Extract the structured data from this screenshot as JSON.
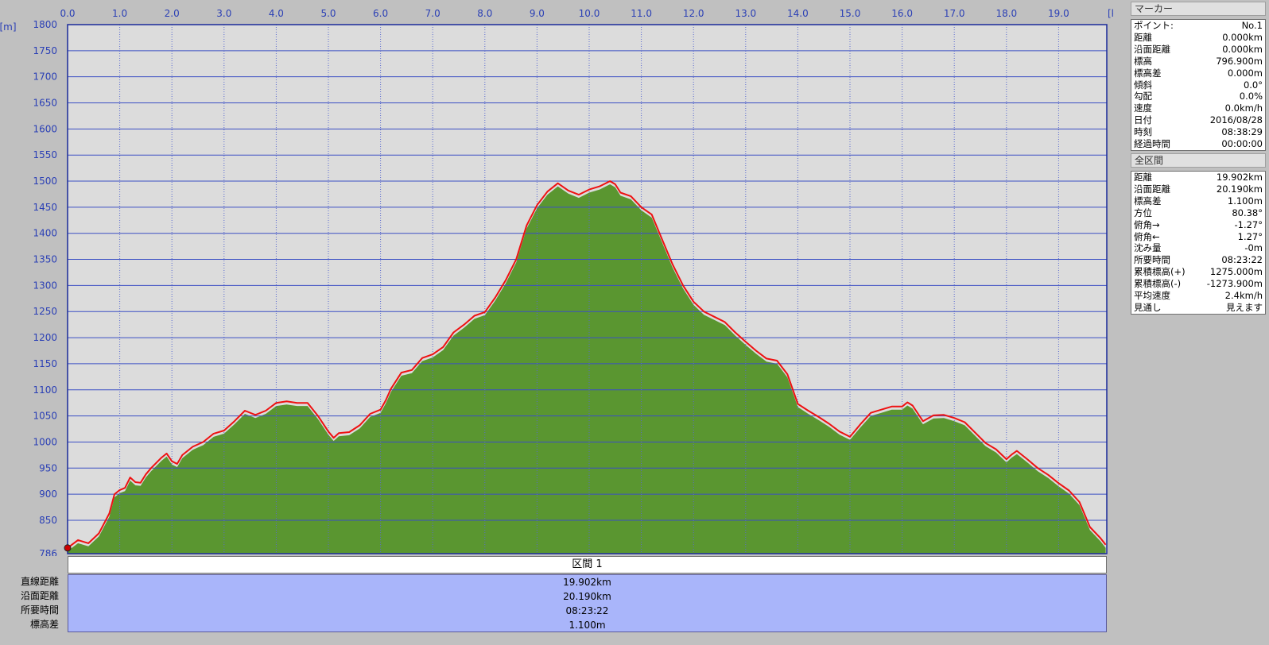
{
  "chart_data": {
    "type": "area",
    "xlabel": "[km]",
    "ylabel": "[m]",
    "xlim": [
      0,
      19.902
    ],
    "ylim": [
      786,
      1800
    ],
    "x_ticks": [
      "0.0",
      "1.0",
      "2.0",
      "3.0",
      "4.0",
      "5.0",
      "6.0",
      "7.0",
      "8.0",
      "9.0",
      "10.0",
      "11.0",
      "12.0",
      "13.0",
      "14.0",
      "15.0",
      "16.0",
      "17.0",
      "18.0",
      "19.0"
    ],
    "y_ticks": [
      "786",
      "850",
      "900",
      "950",
      "1000",
      "1050",
      "1100",
      "1150",
      "1200",
      "1250",
      "1300",
      "1350",
      "1400",
      "1450",
      "1500",
      "1550",
      "1600",
      "1650",
      "1700",
      "1750",
      "1800"
    ],
    "grid": true,
    "series": [
      {
        "x": [
          0,
          0.2,
          0.4,
          0.6,
          0.8,
          0.9,
          1.0,
          1.1,
          1.2,
          1.3,
          1.4,
          1.5,
          1.6,
          1.8,
          1.9,
          2.0,
          2.1,
          2.2,
          2.4,
          2.6,
          2.8,
          3.0,
          3.2,
          3.4,
          3.6,
          3.8,
          4.0,
          4.2,
          4.4,
          4.6,
          4.8,
          5.0,
          5.1,
          5.2,
          5.4,
          5.6,
          5.8,
          6.0,
          6.1,
          6.2,
          6.4,
          6.6,
          6.8,
          7.0,
          7.2,
          7.4,
          7.6,
          7.8,
          8.0,
          8.2,
          8.4,
          8.6,
          8.8,
          9.0,
          9.2,
          9.4,
          9.6,
          9.8,
          10.0,
          10.2,
          10.4,
          10.5,
          10.6,
          10.8,
          11.0,
          11.2,
          11.4,
          11.6,
          11.8,
          12.0,
          12.2,
          12.4,
          12.6,
          12.8,
          13.0,
          13.2,
          13.4,
          13.6,
          13.8,
          14.0,
          14.2,
          14.4,
          14.6,
          14.8,
          15.0,
          15.2,
          15.4,
          15.6,
          15.8,
          16.0,
          16.1,
          16.2,
          16.4,
          16.6,
          16.8,
          17.0,
          17.2,
          17.4,
          17.6,
          17.8,
          18.0,
          18.1,
          18.2,
          18.4,
          18.6,
          18.8,
          19.0,
          19.2,
          19.4,
          19.6,
          19.8,
          19.902
        ],
        "y": [
          797,
          812,
          806,
          825,
          863,
          900,
          908,
          912,
          932,
          923,
          922,
          938,
          950,
          970,
          978,
          963,
          958,
          975,
          991,
          1000,
          1016,
          1022,
          1040,
          1060,
          1052,
          1060,
          1075,
          1078,
          1075,
          1075,
          1050,
          1020,
          1008,
          1017,
          1019,
          1032,
          1054,
          1062,
          1080,
          1102,
          1133,
          1138,
          1161,
          1168,
          1182,
          1210,
          1225,
          1242,
          1249,
          1277,
          1310,
          1350,
          1415,
          1454,
          1480,
          1496,
          1482,
          1474,
          1484,
          1490,
          1500,
          1494,
          1478,
          1471,
          1450,
          1436,
          1388,
          1340,
          1300,
          1269,
          1250,
          1240,
          1230,
          1210,
          1192,
          1175,
          1160,
          1156,
          1130,
          1073,
          1060,
          1048,
          1035,
          1020,
          1010,
          1034,
          1056,
          1062,
          1068,
          1068,
          1076,
          1070,
          1040,
          1051,
          1052,
          1046,
          1038,
          1018,
          998,
          986,
          967,
          976,
          983,
          967,
          950,
          937,
          921,
          907,
          885,
          837,
          816,
          803
        ]
      }
    ]
  },
  "marker_panel": {
    "title": "マーカー",
    "rows": [
      {
        "label": "ポイント:",
        "value": "No.1"
      },
      {
        "label": "距離",
        "value": "0.000km"
      },
      {
        "label": "沿面距離",
        "value": "0.000km"
      },
      {
        "label": "標高",
        "value": "796.900m"
      },
      {
        "label": "標高差",
        "value": "0.000m"
      },
      {
        "label": "傾斜",
        "value": "0.0°"
      },
      {
        "label": "勾配",
        "value": "0.0%"
      },
      {
        "label": "速度",
        "value": "0.0km/h"
      },
      {
        "label": "日付",
        "value": "2016/08/28"
      },
      {
        "label": "時刻",
        "value": "08:38:29"
      },
      {
        "label": "経過時間",
        "value": "00:00:00"
      }
    ]
  },
  "total_panel": {
    "title": "全区間",
    "rows": [
      {
        "label": "距離",
        "value": "19.902km"
      },
      {
        "label": "沿面距離",
        "value": "20.190km"
      },
      {
        "label": "標高差",
        "value": "1.100m"
      },
      {
        "label": "方位",
        "value": "80.38°"
      },
      {
        "label": "俯角→",
        "value": "-1.27°"
      },
      {
        "label": "俯角←",
        "value": "1.27°"
      },
      {
        "label": "沈み量",
        "value": "-0m"
      },
      {
        "label": "所要時間",
        "value": "08:23:22"
      },
      {
        "label": "累積標高(+)",
        "value": "1275.000m"
      },
      {
        "label": "累積標高(-)",
        "value": "-1273.900m"
      },
      {
        "label": "平均速度",
        "value": "2.4km/h"
      },
      {
        "label": "見通し",
        "value": "見えます"
      }
    ]
  },
  "section": {
    "header": "区間 1",
    "rows": [
      {
        "label": "直線距離",
        "value": "19.902km"
      },
      {
        "label": "沿面距離",
        "value": "20.190km"
      },
      {
        "label": "所要時間",
        "value": "08:23:22"
      },
      {
        "label": "標高差",
        "value": "1.100m"
      }
    ]
  },
  "colors": {
    "plot_bg": "#dcdcdc",
    "grid_major": "#3b4fc4",
    "grid_minor": "#5a6ad0",
    "fill": "#5a9630",
    "line": "#ee1111",
    "axis_label": "#2a3fb5",
    "section_bg": "#a9b5fa"
  }
}
